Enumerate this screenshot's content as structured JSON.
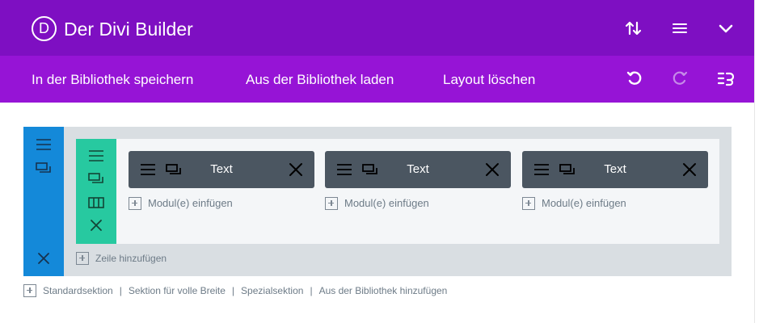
{
  "header": {
    "logo_letter": "D",
    "title": "Der Divi Builder",
    "icons": [
      "sort-icon",
      "menu-icon",
      "chevron-down-icon"
    ]
  },
  "toolbar": {
    "save_library": "In der Bibliothek speichern",
    "load_library": "Aus der Bibliothek laden",
    "clear_layout": "Layout löschen",
    "icons": [
      "undo-icon",
      "redo-icon",
      "portability-icon"
    ]
  },
  "builder": {
    "modules": [
      {
        "label": "Text",
        "add_label": "Modul(e) einfügen"
      },
      {
        "label": "Text",
        "add_label": "Modul(e) einfügen"
      },
      {
        "label": "Text",
        "add_label": "Modul(e) einfügen"
      }
    ],
    "add_row": "Zeile hinzufügen"
  },
  "footer": {
    "links": [
      "Standardsektion",
      "Sektion für volle Breite",
      "Spezialsektion",
      "Aus der Bibliothek hinzufügen"
    ],
    "separator": "|"
  },
  "colors": {
    "header_bg": "#7e0fc2",
    "toolbar_bg": "#9614d6",
    "section_handle": "#1489d9",
    "row_handle": "#27c9a0",
    "module_bg": "#4b5661"
  }
}
